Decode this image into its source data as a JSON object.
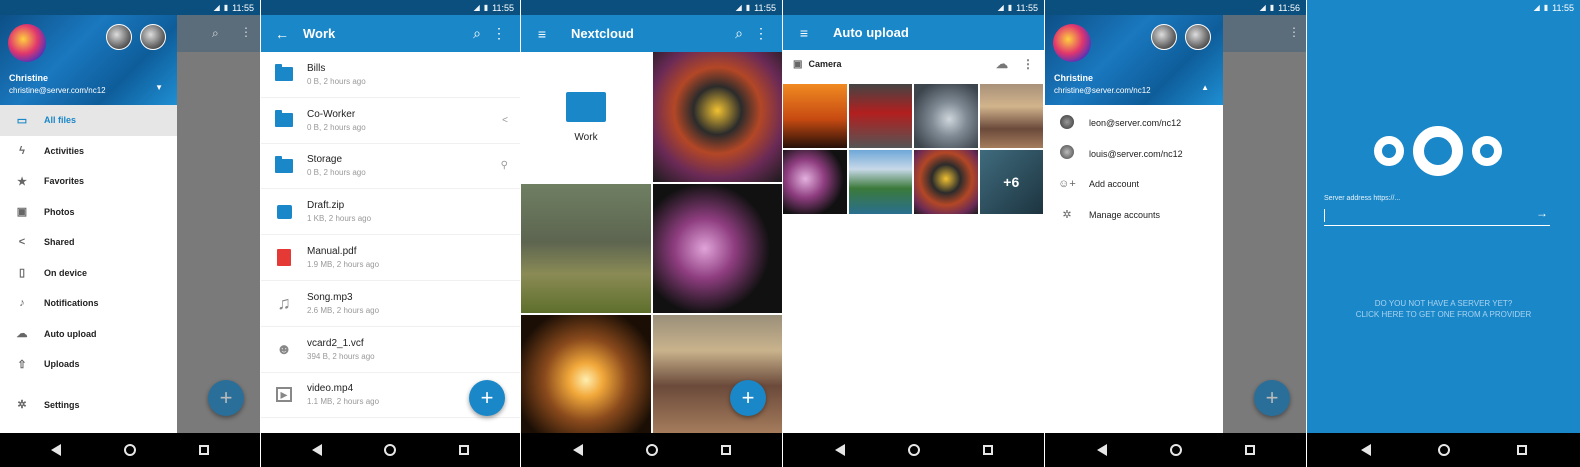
{
  "status": {
    "time_1": "11:55",
    "time_2": "11:55",
    "time_3": "11:55",
    "time_4": "11:55",
    "time_5": "11:56",
    "time_6": "11:55"
  },
  "drawer": {
    "name": "Christine",
    "email": "christine@server.com/nc12",
    "items": [
      {
        "label": "All files",
        "icon": "folder-icon"
      },
      {
        "label": "Activities",
        "icon": "bolt-icon"
      },
      {
        "label": "Favorites",
        "icon": "star-icon"
      },
      {
        "label": "Photos",
        "icon": "image-icon"
      },
      {
        "label": "Shared",
        "icon": "share-icon"
      },
      {
        "label": "On device",
        "icon": "phone-icon"
      },
      {
        "label": "Notifications",
        "icon": "bell-icon"
      },
      {
        "label": "Auto upload",
        "icon": "cloud-upload-icon"
      },
      {
        "label": "Uploads",
        "icon": "upload-icon"
      },
      {
        "label": "Settings",
        "icon": "gear-icon"
      }
    ]
  },
  "work": {
    "title": "Work",
    "files": [
      {
        "name": "Bills",
        "meta": "0 B, 2 hours ago",
        "type": "folder"
      },
      {
        "name": "Co-Worker",
        "meta": "0 B, 2 hours ago",
        "type": "shared-folder"
      },
      {
        "name": "Storage",
        "meta": "0 B, 2 hours ago",
        "type": "link-folder"
      },
      {
        "name": "Draft.zip",
        "meta": "1 KB, 2 hours ago",
        "type": "zip"
      },
      {
        "name": "Manual.pdf",
        "meta": "1.9 MB, 2 hours ago",
        "type": "pdf"
      },
      {
        "name": "Song.mp3",
        "meta": "2.6 MB, 2 hours ago",
        "type": "audio"
      },
      {
        "name": "vcard2_1.vcf",
        "meta": "394 B, 2 hours ago",
        "type": "contact"
      },
      {
        "name": "video.mp4",
        "meta": "1.1 MB, 2 hours ago",
        "type": "video"
      }
    ]
  },
  "nextcloud": {
    "title": "Nextcloud",
    "folder_label": "Work"
  },
  "autoupload": {
    "title": "Auto upload",
    "folder": "Camera",
    "more_count": "+6"
  },
  "accounts": {
    "name": "Christine",
    "email": "christine@server.com/nc12",
    "items": [
      {
        "label": "leon@server.com/nc12"
      },
      {
        "label": "louis@server.com/nc12"
      },
      {
        "label": "Add account"
      },
      {
        "label": "Manage accounts"
      }
    ]
  },
  "server": {
    "address_label": "Server address https://...",
    "hint_line1": "DO YOU NOT HAVE A SERVER YET?",
    "hint_line2": "CLICK HERE TO GET ONE FROM A PROVIDER"
  },
  "colors": {
    "primary": "#1a87c8",
    "statusbar": "#0a4f7e"
  }
}
